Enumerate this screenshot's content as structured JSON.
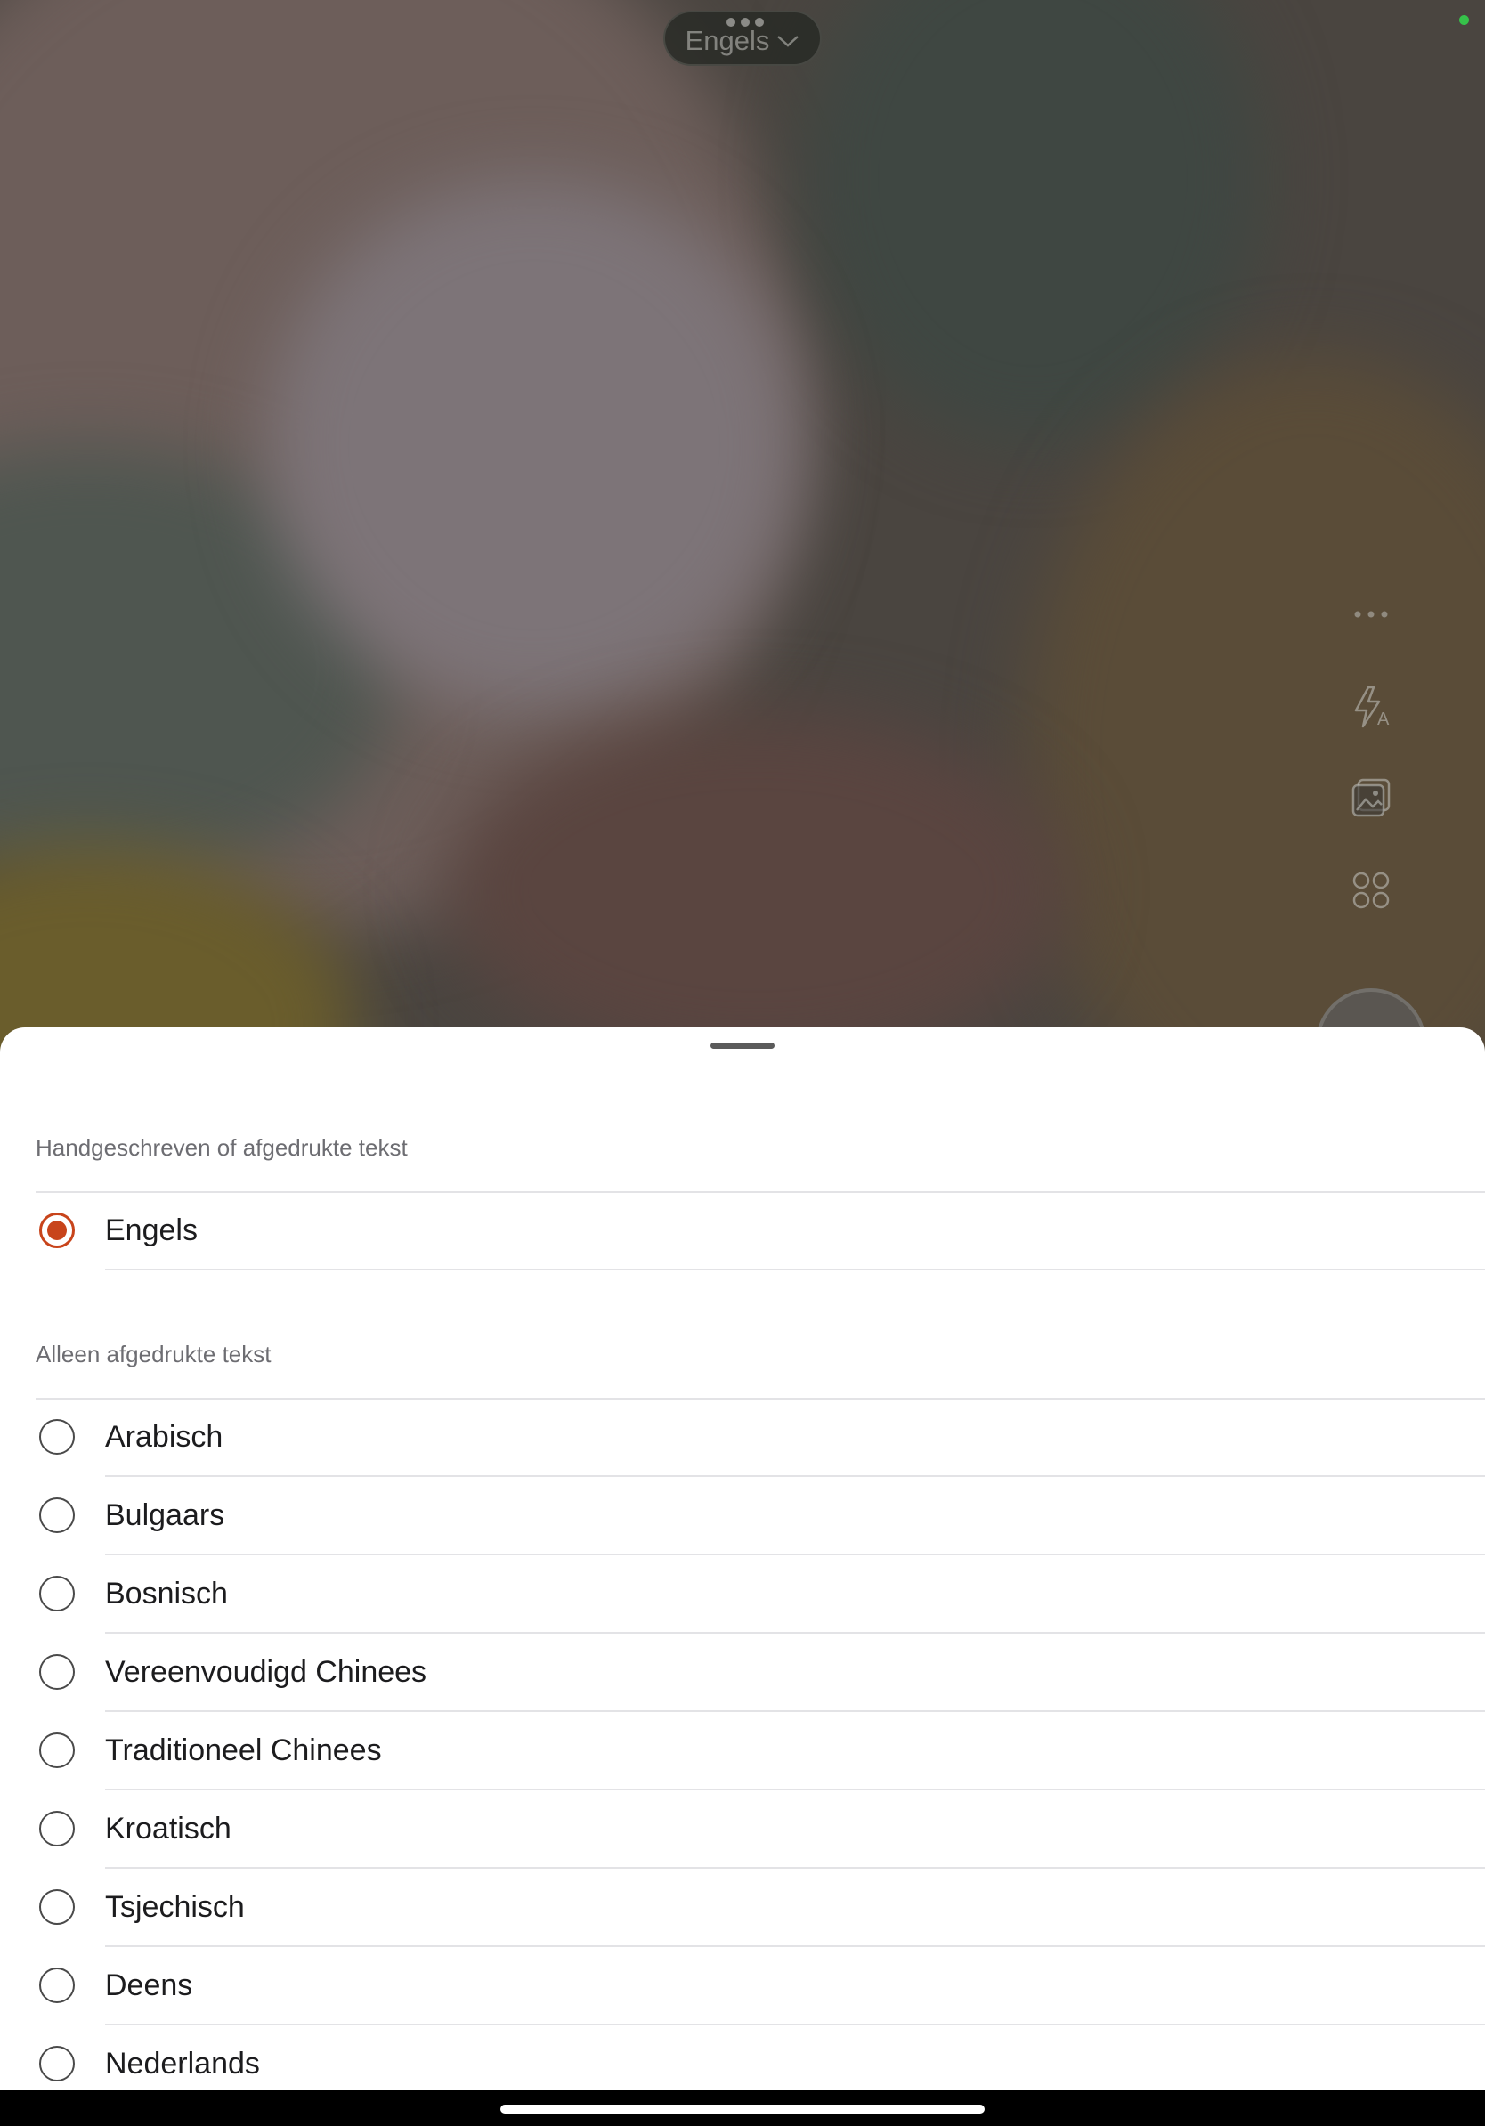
{
  "camera": {
    "language_pill": {
      "label": "Engels"
    }
  },
  "colors": {
    "accent": "#c8441b",
    "camera_indicator": "#36c24a"
  },
  "side_toolbar": [
    {
      "icon": "more-icon"
    },
    {
      "icon": "flash-auto-icon"
    },
    {
      "icon": "photo-library-icon"
    },
    {
      "icon": "apps-grid-icon"
    }
  ],
  "sheet": {
    "section_handwritten": {
      "header": "Handgeschreven of afgedrukte tekst",
      "items": [
        {
          "label": "Engels",
          "selected": true
        }
      ]
    },
    "section_printed": {
      "header": "Alleen afgedrukte tekst",
      "items": [
        {
          "label": "Arabisch",
          "selected": false
        },
        {
          "label": "Bulgaars",
          "selected": false
        },
        {
          "label": "Bosnisch",
          "selected": false
        },
        {
          "label": "Vereenvoudigd Chinees",
          "selected": false
        },
        {
          "label": "Traditioneel Chinees",
          "selected": false
        },
        {
          "label": "Kroatisch",
          "selected": false
        },
        {
          "label": "Tsjechisch",
          "selected": false
        },
        {
          "label": "Deens",
          "selected": false
        },
        {
          "label": "Nederlands",
          "selected": false
        }
      ]
    }
  }
}
